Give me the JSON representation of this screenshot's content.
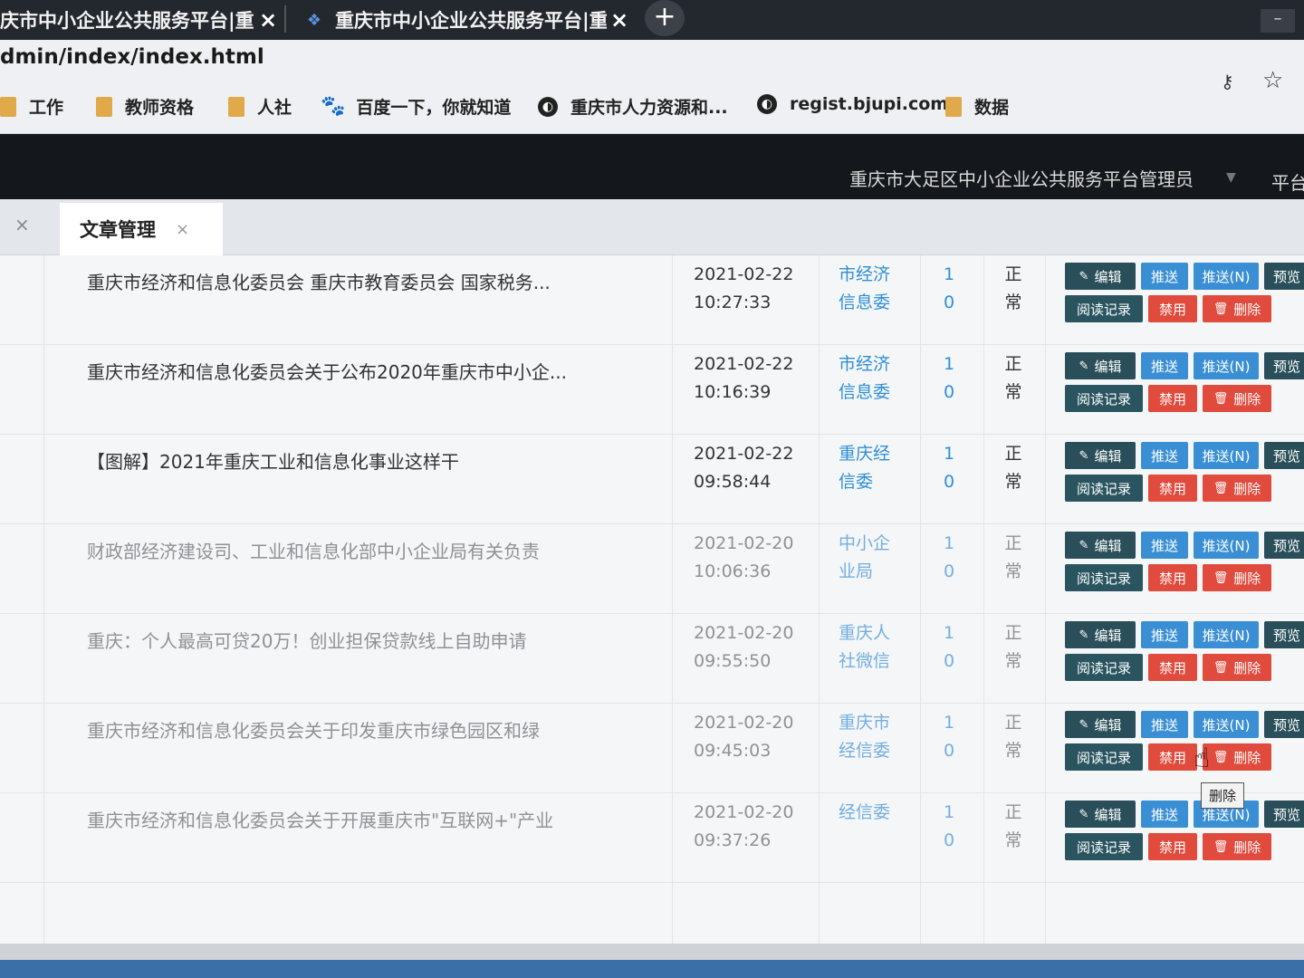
{
  "browser": {
    "tabs": [
      {
        "title": "庆市中小企业公共服务平台|重",
        "close": "×"
      },
      {
        "title": "重庆市中小企业公共服务平台|重",
        "close": "×"
      }
    ],
    "new_tab": "+",
    "minimize": "–",
    "url": "dmin/index/index.html",
    "key_icon": "key-icon",
    "star_icon": "star-icon"
  },
  "bookmarks": [
    {
      "label": "工作",
      "icon": "folder-icon"
    },
    {
      "label": "教师资格",
      "icon": "folder-icon"
    },
    {
      "label": "人社",
      "icon": "folder-icon"
    },
    {
      "label": "百度一下，你就知道",
      "icon": "baidu-paw-icon"
    },
    {
      "label": "重庆市人力资源和...",
      "icon": "globe-icon"
    },
    {
      "label": "regist.bjupi.com",
      "icon": "globe-icon"
    },
    {
      "label": "数据",
      "icon": "folder-icon"
    }
  ],
  "header": {
    "user": "重庆市大足区中小企业公共服务平台管理员",
    "platform": "平台"
  },
  "page_tabs": {
    "home_close": "×",
    "active_label": "文章管理",
    "active_close": "×"
  },
  "buttons": {
    "edit": "编辑",
    "push": "推送",
    "push_n": "推送(N)",
    "preview": "预览",
    "read_log": "阅读记录",
    "disable": "禁用",
    "delete": "删除"
  },
  "tooltip": "删除",
  "rows": [
    {
      "title": "重庆市经济和信息化委员会 重庆市教育委员会 国家税务...",
      "date": "2021-02-22",
      "time": "10:27:33",
      "source": "市经济信息委",
      "count_a": "1",
      "count_b": "0",
      "status": "正常"
    },
    {
      "title": "重庆市经济和信息化委员会关于公布2020年重庆市中小企...",
      "date": "2021-02-22",
      "time": "10:16:39",
      "source": "市经济信息委",
      "count_a": "1",
      "count_b": "0",
      "status": "正常"
    },
    {
      "title": "【图解】2021年重庆工业和信息化事业这样干",
      "date": "2021-02-22",
      "time": "09:58:44",
      "source": "重庆经信委",
      "count_a": "1",
      "count_b": "0",
      "status": "正常"
    },
    {
      "title": "财政部经济建设司、工业和信息化部中小企业局有关负责",
      "date": "2021-02-20",
      "time": "10:06:36",
      "source": "中小企业局",
      "count_a": "1",
      "count_b": "0",
      "status": "正常"
    },
    {
      "title": "重庆：个人最高可贷20万！创业担保贷款线上自助申请",
      "date": "2021-02-20",
      "time": "09:55:50",
      "source": "重庆人社微信",
      "count_a": "1",
      "count_b": "0",
      "status": "正常"
    },
    {
      "title": "重庆市经济和信息化委员会关于印发重庆市绿色园区和绿",
      "date": "2021-02-20",
      "time": "09:45:03",
      "source": "重庆市经信委",
      "count_a": "1",
      "count_b": "0",
      "status": "正常"
    },
    {
      "title": "重庆市经济和信息化委员会关于开展重庆市\"互联网+\"产业",
      "date": "2021-02-20",
      "time": "09:37:26",
      "source": "经信委",
      "count_a": "1",
      "count_b": "0",
      "status": "正常"
    }
  ]
}
